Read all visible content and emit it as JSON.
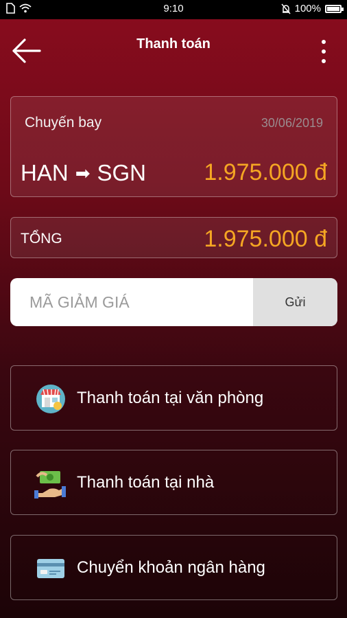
{
  "status": {
    "time": "9:10",
    "battery": "100%"
  },
  "header": {
    "title": "Thanh toán"
  },
  "flight": {
    "label": "Chuyến bay",
    "date": "30/06/2019",
    "from": "HAN",
    "to": "SGN",
    "price": "1.975.000 đ"
  },
  "total": {
    "label": "TỔNG",
    "price": "1.975.000 đ"
  },
  "promo": {
    "placeholder": "MÃ GIẢM GIÁ",
    "button": "Gửi"
  },
  "payment_options": [
    {
      "label": "Thanh toán tại văn phòng",
      "icon": "store-icon"
    },
    {
      "label": "Thanh toán tại nhà",
      "icon": "cash-hand-icon"
    },
    {
      "label": "Chuyển khoản ngân hàng",
      "icon": "bank-card-icon"
    }
  ],
  "colors": {
    "accent": "#f5a623",
    "background_top": "#8a0c1e",
    "background_bottom": "#1c0407"
  }
}
